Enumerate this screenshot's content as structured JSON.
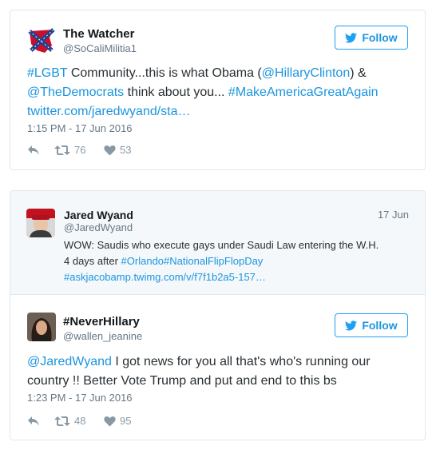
{
  "tweet1": {
    "name": "The Watcher",
    "handle": "@SoCaliMilitia1",
    "follow_label": "Follow",
    "text": {
      "h1": "#LGBT",
      "t1": " Community...this is what Obama (",
      "m1": "@HillaryClinton",
      "t2": ") &",
      "m2": "@TheDemocrats",
      "t3": " think about you... ",
      "h2": "#MakeAmericaGreatAgain",
      "url": "twitter.com/jaredwyand/sta…"
    },
    "timestamp": "1:15 PM - 17 Jun 2016",
    "retweets": "76",
    "likes": "53"
  },
  "quoted": {
    "name": "Jared Wyand",
    "handle": "@JaredWyand",
    "date": "17 Jun",
    "line1": "WOW: Saudis who execute gays under Saudi Law entering the W.H.",
    "line2_a": "4 days after ",
    "line2_h1": "#Orlando",
    "line2_h2": "#NationalFlipFlopDay",
    "line3": "#askjacobamp.twimg.com/v/f7f1b2a5-157…"
  },
  "tweet2": {
    "name": "#NeverHillary",
    "handle": "@wallen_jeanine",
    "follow_label": "Follow",
    "text": {
      "mention": "@JaredWyand",
      "t1": " I got news for you all that's who's running our",
      "t2": "country !! Better Vote Trump and put and end to this bs"
    },
    "timestamp": "1:23 PM - 17 Jun 2016",
    "retweets": "48",
    "likes": "95"
  },
  "icons": {
    "follow": "bird-icon",
    "reply": "reply-icon",
    "retweet": "retweet-icon",
    "like": "heart-icon"
  },
  "colors": {
    "link": "#1b95e0",
    "muted": "#657786",
    "border": "#e1e8ed",
    "quote_bg": "#f5f8fa"
  }
}
